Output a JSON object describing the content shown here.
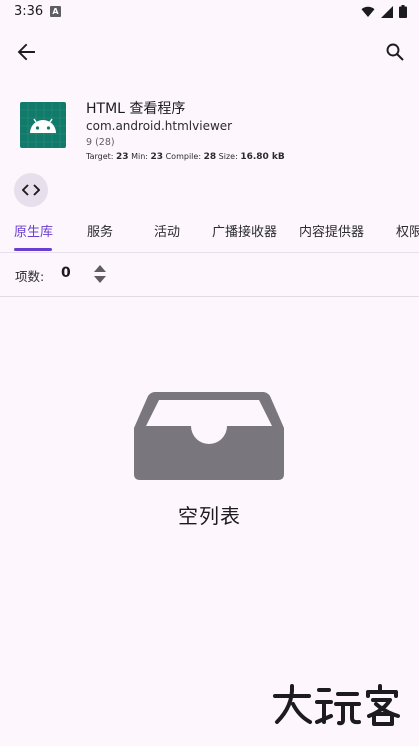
{
  "status_bar": {
    "time": "3:36",
    "notification_icon": "A"
  },
  "toolbar": {
    "back_icon": "arrow-back",
    "search_icon": "search"
  },
  "app": {
    "name": "HTML 查看程序",
    "package": "com.android.htmlviewer",
    "version": "9 (28)",
    "target_label": "Target:",
    "target_value": "23",
    "min_label": "Min:",
    "min_value": "23",
    "compile_label": "Compile:",
    "compile_value": "28",
    "size_label": "Size:",
    "size_value": "16.80 kB",
    "icon_color": "#127a6a"
  },
  "tabs": [
    {
      "label": "原生库",
      "active": true
    },
    {
      "label": "服务",
      "active": false
    },
    {
      "label": "活动",
      "active": false
    },
    {
      "label": "广播接收器",
      "active": false
    },
    {
      "label": "内容提供器",
      "active": false
    },
    {
      "label": "权限",
      "active": false
    }
  ],
  "count": {
    "label": "项数:",
    "value": "0"
  },
  "empty_state": {
    "text": "空列表",
    "icon": "inbox-tray"
  },
  "watermark": {
    "text": "大玩客"
  },
  "colors": {
    "accent": "#6a3fd0",
    "background": "#fdf7fd"
  }
}
